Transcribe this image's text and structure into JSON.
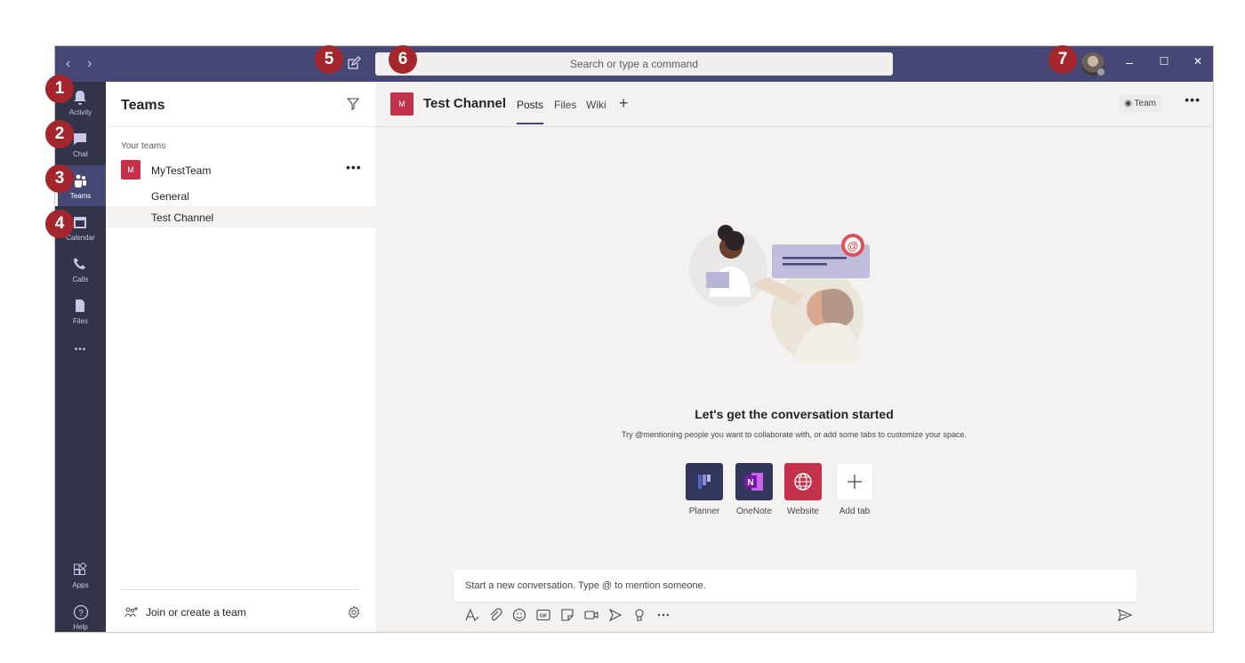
{
  "titlebar": {
    "back_icon": "chevron-left-icon",
    "forward_icon": "chevron-right-icon",
    "compose_icon": "compose-icon",
    "search_placeholder": "Search or type a command",
    "minimize": "–",
    "maximize": "☐",
    "close": "✕"
  },
  "rail": {
    "items": [
      {
        "label": "Activity",
        "icon": "bell-icon"
      },
      {
        "label": "Chat",
        "icon": "chat-icon"
      },
      {
        "label": "Teams",
        "icon": "teams-icon",
        "active": true
      },
      {
        "label": "Calendar",
        "icon": "calendar-icon"
      },
      {
        "label": "Calls",
        "icon": "phone-icon"
      },
      {
        "label": "Files",
        "icon": "file-icon"
      }
    ],
    "more": "•••",
    "apps_label": "Apps",
    "help_label": "Help"
  },
  "teams_panel": {
    "title": "Teams",
    "section_label": "Your teams",
    "team": {
      "initial": "M",
      "name": "MyTestTeam",
      "more": "•••"
    },
    "channels": [
      "General",
      "Test Channel"
    ],
    "join_label": "Join or create a team"
  },
  "channel": {
    "initial": "M",
    "title": "Test Channel",
    "tabs": [
      "Posts",
      "Files",
      "Wiki"
    ],
    "add_tab": "+",
    "team_pill": "Team",
    "more": "•••"
  },
  "empty_state": {
    "title": "Let's get the conversation started",
    "subtitle": "Try @mentioning people you want to collaborate with, or add some tabs to customize your space.",
    "apps": [
      {
        "label": "Planner",
        "color": "#31365a",
        "icon": "planner-icon"
      },
      {
        "label": "OneNote",
        "color": "#31365a",
        "icon": "onenote-icon"
      },
      {
        "label": "Website",
        "color": "#c4314b",
        "icon": "globe-icon"
      },
      {
        "label": "Add tab",
        "color": "#ffffff",
        "icon": "plus-icon"
      }
    ]
  },
  "composer": {
    "placeholder": "Start a new conversation. Type @ to mention someone."
  },
  "callouts": [
    "1",
    "2",
    "3",
    "4",
    "5",
    "6",
    "7"
  ],
  "colors": {
    "titlebar": "#464775",
    "rail": "#33344a",
    "accent": "#464775",
    "badge": "#a4262c",
    "team_tile": "#c4314b"
  }
}
